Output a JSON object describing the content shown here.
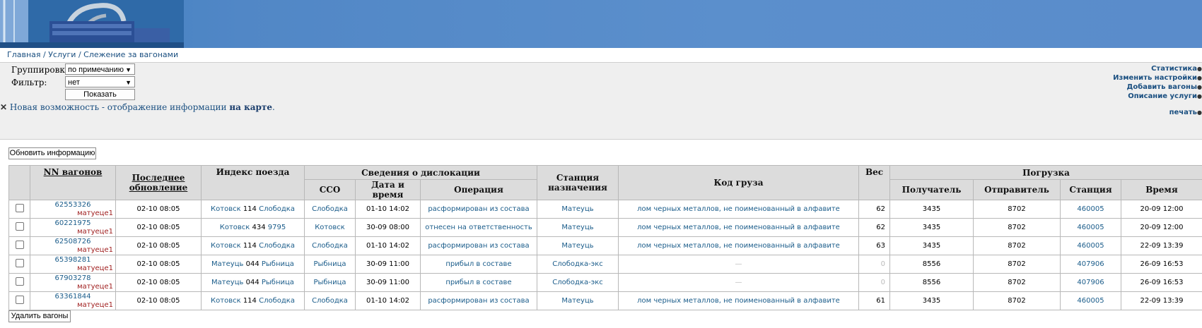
{
  "breadcrumb": [
    "Главная",
    "Услуги",
    "Слежение за вагонами"
  ],
  "controls": {
    "group_label": "Группировка:",
    "group_value": "по примечанию",
    "filter_label": "Фильтр:",
    "filter_value": "нет",
    "show_button": "Показать",
    "new_feature_text": "Новая возможность - отображение информации",
    "new_feature_link": "на карте",
    "new_feature_end": "."
  },
  "right_links": [
    "Статистика",
    "Изменить настройки",
    "Добавить вагоны",
    "Описание услуги",
    "печать"
  ],
  "refresh_button": "Обновить информацию",
  "delete_button": "Удалить вагоны",
  "table": {
    "headers": {
      "wagons": "NN вагонов",
      "last_update": "Последнее обновление",
      "train_index": "Индекс поезда",
      "dislocation": "Сведения о дислокации",
      "sso": "ССО",
      "datetime": "Дата и время",
      "operation": "Операция",
      "dest_station": "Станция назначения",
      "cargo_code": "Код груза",
      "weight": "Вес",
      "loading": "Погрузка",
      "receiver": "Получатель",
      "sender": "Отправитель",
      "station": "Станция",
      "time": "Время"
    },
    "rows": [
      {
        "wagon": "62553326",
        "note": "матуеце1",
        "updated": "02-10 08:05",
        "idx_from": "Котовск",
        "idx_num": "114",
        "idx_to": "Слободка",
        "sso": "Слободка",
        "dt": "01-10 14:02",
        "op": "расформирован из состава",
        "dest": "Матеуць",
        "cargo": "лом черных металлов, не поименованный в алфавите",
        "weight": "62",
        "receiver": "3435",
        "sender": "8702",
        "station": "460005",
        "time": "20-09 12:00"
      },
      {
        "wagon": "60221975",
        "note": "матуеце1",
        "updated": "02-10 08:05",
        "idx_from": "Котовск",
        "idx_num": "434",
        "idx_to": "9795",
        "sso": "Котовск",
        "dt": "30-09 08:00",
        "op": "отнесен на ответственность",
        "dest": "Матеуць",
        "cargo": "лом черных металлов, не поименованный в алфавите",
        "weight": "62",
        "receiver": "3435",
        "sender": "8702",
        "station": "460005",
        "time": "20-09 12:00"
      },
      {
        "wagon": "62508726",
        "note": "матуеце1",
        "updated": "02-10 08:05",
        "idx_from": "Котовск",
        "idx_num": "114",
        "idx_to": "Слободка",
        "sso": "Слободка",
        "dt": "01-10 14:02",
        "op": "расформирован из состава",
        "dest": "Матеуць",
        "cargo": "лом черных металлов, не поименованный в алфавите",
        "weight": "63",
        "receiver": "3435",
        "sender": "8702",
        "station": "460005",
        "time": "22-09 13:39"
      },
      {
        "wagon": "65398281",
        "note": "матуеце1",
        "updated": "02-10 08:05",
        "idx_from": "Матеуць",
        "idx_num": "044",
        "idx_to": "Рыбница",
        "sso": "Рыбница",
        "dt": "30-09 11:00",
        "op": "прибыл в составе",
        "dest": "Слободка-экс",
        "cargo": "—",
        "weight": "0",
        "receiver": "8556",
        "sender": "8702",
        "station": "407906",
        "time": "26-09 16:53"
      },
      {
        "wagon": "67903278",
        "note": "матуеце1",
        "updated": "02-10 08:05",
        "idx_from": "Матеуць",
        "idx_num": "044",
        "idx_to": "Рыбница",
        "sso": "Рыбница",
        "dt": "30-09 11:00",
        "op": "прибыл в составе",
        "dest": "Слободка-экс",
        "cargo": "—",
        "weight": "0",
        "receiver": "8556",
        "sender": "8702",
        "station": "407906",
        "time": "26-09 16:53"
      },
      {
        "wagon": "63361844",
        "note": "матуеце1",
        "updated": "02-10 08:05",
        "idx_from": "Котовск",
        "idx_num": "114",
        "idx_to": "Слободка",
        "sso": "Слободка",
        "dt": "01-10 14:02",
        "op": "расформирован из состава",
        "dest": "Матеуць",
        "cargo": "лом черных металлов, не поименованный в алфавите",
        "weight": "61",
        "receiver": "3435",
        "sender": "8702",
        "station": "460005",
        "time": "22-09 13:39"
      }
    ]
  }
}
